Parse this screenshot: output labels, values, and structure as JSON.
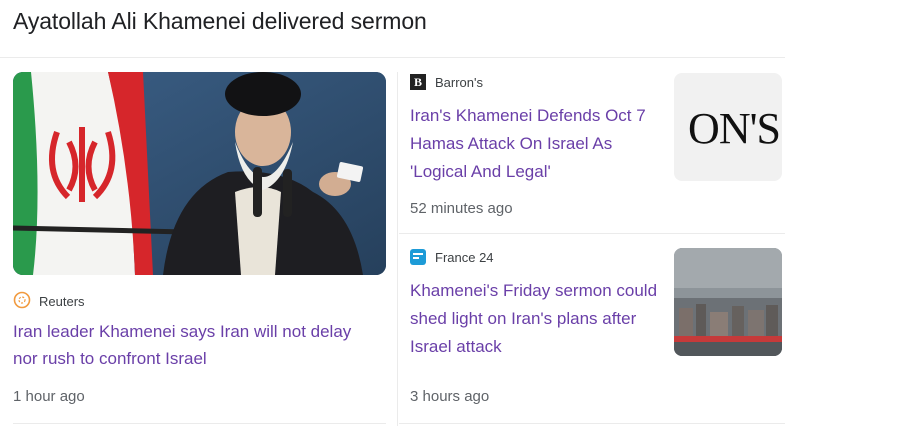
{
  "heading": "Ayatollah Ali Khamenei delivered sermon",
  "colors": {
    "link": "#6a3fa8",
    "meta": "#5f6368",
    "divider": "#ebebeb"
  },
  "stories": {
    "featured": {
      "source": "Reuters",
      "source_icon": "reuters-logo-icon",
      "title": "Iran leader Khamenei says Iran will not delay nor rush to confront Israel",
      "time": "1 hour ago"
    },
    "barrons": {
      "source": "Barron's",
      "source_icon": "barrons-logo-icon",
      "title": "Iran's Khamenei Defends Oct 7 Hamas Attack On Israel As 'Logical And Legal'",
      "time": "52 minutes ago",
      "thumb_text": "ON'S"
    },
    "france24": {
      "source": "France 24",
      "source_icon": "france24-logo-icon",
      "title": "Khamenei's Friday sermon could shed light on Iran's plans after Israel attack",
      "time": "3 hours ago"
    }
  }
}
